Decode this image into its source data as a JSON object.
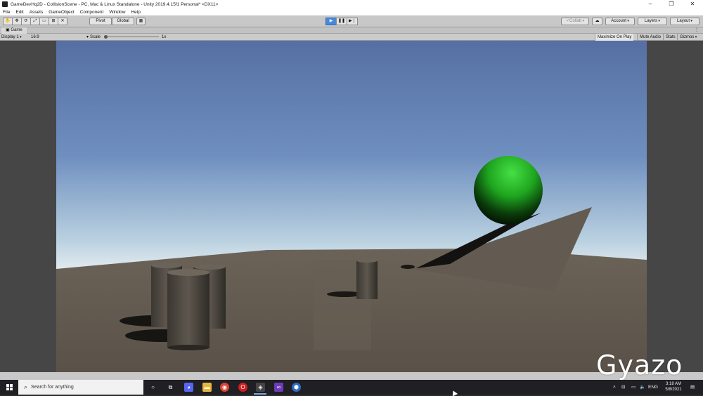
{
  "window": {
    "title": "GameDevHq2D - CollisionScene - PC, Mac & Linux Standalone - Unity 2019.4.15f1 Personal* <DX11>",
    "controls": [
      "‒",
      "❐",
      "✕"
    ]
  },
  "menu": [
    "File",
    "Edit",
    "Assets",
    "GameObject",
    "Component",
    "Window",
    "Help"
  ],
  "toolbar": {
    "pivot_label": "Pivot",
    "global_label": "Global",
    "collab_label": "Collab",
    "account_label": "Account",
    "layers_label": "Layers",
    "layout_label": "Layout",
    "play_state": "playing"
  },
  "game_tab": {
    "label": "Game"
  },
  "game_bar": {
    "display": "Display 1",
    "aspect": "16:9",
    "scale_label": "Scale",
    "scale_value": "1x",
    "maximize": "Maximize On Play",
    "mute": "Mute Audio",
    "stats": "Stats",
    "gizmos": "Gizmos"
  },
  "watermark": "Gyazo",
  "taskbar": {
    "search_placeholder": "Search for anything",
    "tray_lang": "ENG",
    "time": "3:18 AM",
    "date": "5/8/2021"
  },
  "colors": {
    "sky_top": "#5a76a8",
    "sky_horizon": "#dfe9ee",
    "ground": "#5e5850",
    "sphere": "#2fbe2f",
    "ramp": "#5f584f",
    "play_accent": "#4a89d8"
  }
}
